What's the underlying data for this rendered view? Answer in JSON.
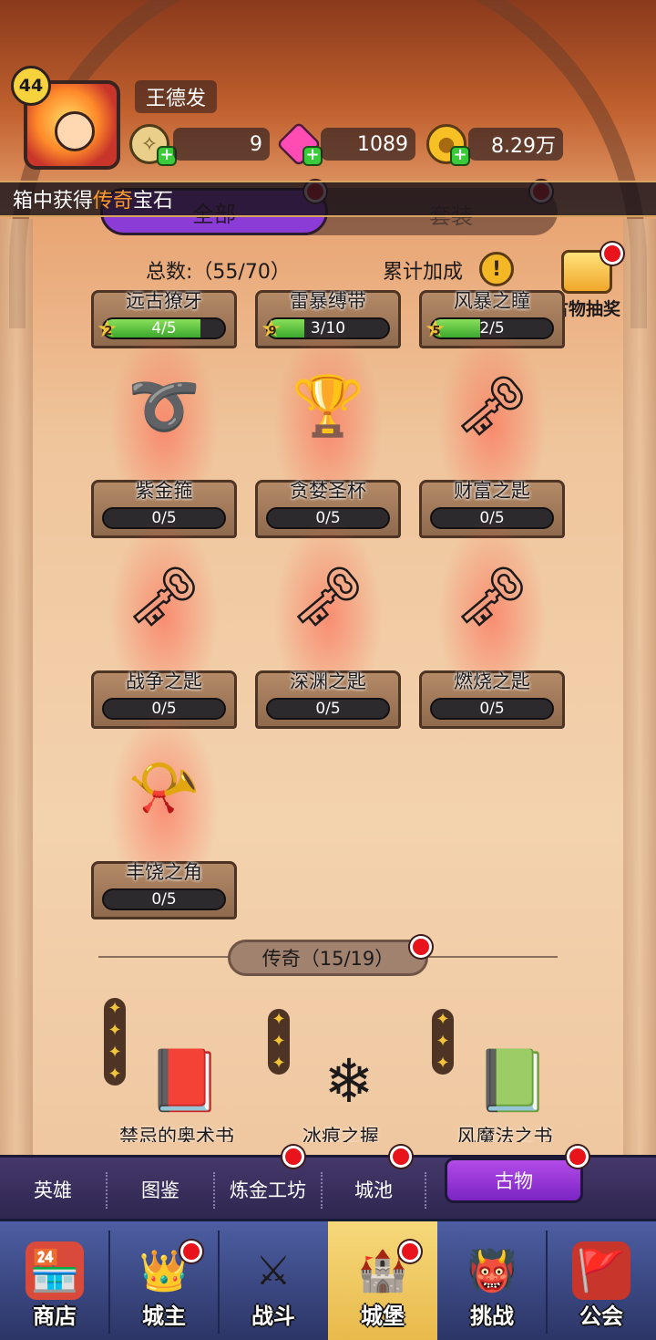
{
  "player": {
    "level": "44",
    "name": "王德发"
  },
  "resources": [
    {
      "icon": "scroll-token-icon",
      "value": "9"
    },
    {
      "icon": "pink-gem-icon",
      "value": "1089"
    },
    {
      "icon": "gold-coin-icon",
      "value": "8.29万"
    }
  ],
  "ticker": {
    "prefix": "箱中获得",
    "highlight": "传奇",
    "suffix": "宝石"
  },
  "tabs": {
    "all": "全部",
    "set": "套装"
  },
  "stats": {
    "total_label": "总数:（55/70）",
    "bonus_label": "累计加成",
    "warn_glyph": "!"
  },
  "lottery": {
    "label": "古物抽奖"
  },
  "relics": [
    {
      "name": "远古獠牙",
      "progress": "4/5",
      "fill": 0.8,
      "stars": "2",
      "icon": "fang-icon",
      "glyph": "🦷"
    },
    {
      "name": "雷暴缚带",
      "progress": "3/10",
      "fill": 0.3,
      "stars": "9",
      "icon": "thunder-band-icon",
      "glyph": "⚡"
    },
    {
      "name": "风暴之瞳",
      "progress": "2/5",
      "fill": 0.4,
      "stars": "5",
      "icon": "storm-eye-icon",
      "glyph": "👁"
    },
    {
      "name": "紫金箍",
      "progress": "0/5",
      "fill": 0,
      "icon": "golden-circlet-icon",
      "glyph": "➰"
    },
    {
      "name": "贪婪圣杯",
      "progress": "0/5",
      "fill": 0,
      "icon": "greed-grail-icon",
      "glyph": "🏆"
    },
    {
      "name": "财富之匙",
      "progress": "0/5",
      "fill": 0,
      "icon": "wealth-key-icon",
      "glyph": "🗝"
    },
    {
      "name": "战争之匙",
      "progress": "0/5",
      "fill": 0,
      "icon": "war-key-icon",
      "glyph": "🗝"
    },
    {
      "name": "深渊之匙",
      "progress": "0/5",
      "fill": 0,
      "icon": "abyss-key-icon",
      "glyph": "🗝"
    },
    {
      "name": "燃烧之匙",
      "progress": "0/5",
      "fill": 0,
      "icon": "burning-key-icon",
      "glyph": "🗝"
    },
    {
      "name": "丰饶之角",
      "progress": "0/5",
      "fill": 0,
      "icon": "horn-of-plenty-icon",
      "glyph": "📯"
    }
  ],
  "legendary": {
    "label": "传奇（15/19）",
    "items": [
      {
        "name": "禁忌的奥术书",
        "icon": "forbidden-arcane-book-icon",
        "glyph": "📕"
      },
      {
        "name": "冰痕之握",
        "icon": "ice-grip-icon",
        "glyph": "❄"
      },
      {
        "name": "风魔法之书",
        "icon": "wind-magic-book-icon",
        "glyph": "📗"
      }
    ],
    "star_glyph": "✦"
  },
  "subnav": [
    "英雄",
    "图鉴",
    "炼金工坊",
    "城池",
    "古物"
  ],
  "mainnav": [
    {
      "label": "商店",
      "icon": "shop-icon",
      "glyph": "🏪"
    },
    {
      "label": "城主",
      "icon": "crown-icon",
      "glyph": "👑"
    },
    {
      "label": "战斗",
      "icon": "crossed-swords-icon",
      "glyph": "⚔"
    },
    {
      "label": "城堡",
      "icon": "castle-icon",
      "glyph": "🏰"
    },
    {
      "label": "挑战",
      "icon": "demon-helmet-icon",
      "glyph": "👹"
    },
    {
      "label": "公会",
      "icon": "guild-banner-icon",
      "glyph": "🚩"
    }
  ],
  "colors": {
    "accent": "#8b3bd6",
    "notify": "#e8131b",
    "progress": "#3aa82e"
  }
}
